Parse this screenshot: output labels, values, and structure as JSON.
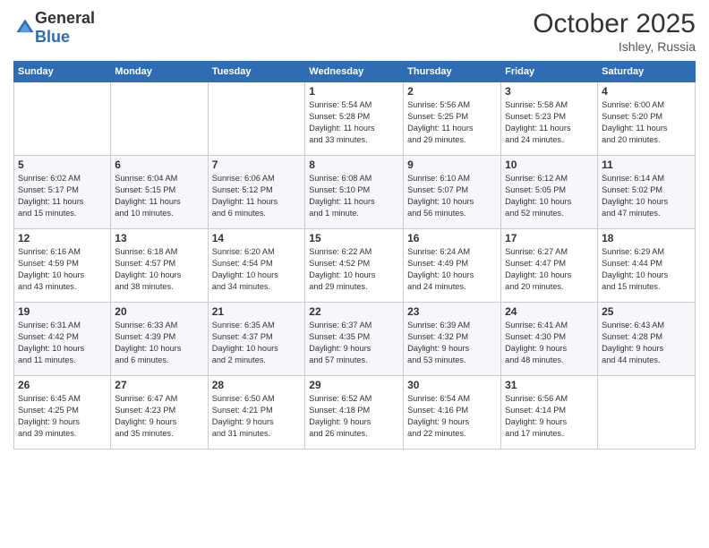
{
  "logo": {
    "general": "General",
    "blue": "Blue"
  },
  "title": "October 2025",
  "location": "Ishley, Russia",
  "days_header": [
    "Sunday",
    "Monday",
    "Tuesday",
    "Wednesday",
    "Thursday",
    "Friday",
    "Saturday"
  ],
  "weeks": [
    [
      {
        "day": "",
        "info": ""
      },
      {
        "day": "",
        "info": ""
      },
      {
        "day": "",
        "info": ""
      },
      {
        "day": "1",
        "info": "Sunrise: 5:54 AM\nSunset: 5:28 PM\nDaylight: 11 hours\nand 33 minutes."
      },
      {
        "day": "2",
        "info": "Sunrise: 5:56 AM\nSunset: 5:25 PM\nDaylight: 11 hours\nand 29 minutes."
      },
      {
        "day": "3",
        "info": "Sunrise: 5:58 AM\nSunset: 5:23 PM\nDaylight: 11 hours\nand 24 minutes."
      },
      {
        "day": "4",
        "info": "Sunrise: 6:00 AM\nSunset: 5:20 PM\nDaylight: 11 hours\nand 20 minutes."
      }
    ],
    [
      {
        "day": "5",
        "info": "Sunrise: 6:02 AM\nSunset: 5:17 PM\nDaylight: 11 hours\nand 15 minutes."
      },
      {
        "day": "6",
        "info": "Sunrise: 6:04 AM\nSunset: 5:15 PM\nDaylight: 11 hours\nand 10 minutes."
      },
      {
        "day": "7",
        "info": "Sunrise: 6:06 AM\nSunset: 5:12 PM\nDaylight: 11 hours\nand 6 minutes."
      },
      {
        "day": "8",
        "info": "Sunrise: 6:08 AM\nSunset: 5:10 PM\nDaylight: 11 hours\nand 1 minute."
      },
      {
        "day": "9",
        "info": "Sunrise: 6:10 AM\nSunset: 5:07 PM\nDaylight: 10 hours\nand 56 minutes."
      },
      {
        "day": "10",
        "info": "Sunrise: 6:12 AM\nSunset: 5:05 PM\nDaylight: 10 hours\nand 52 minutes."
      },
      {
        "day": "11",
        "info": "Sunrise: 6:14 AM\nSunset: 5:02 PM\nDaylight: 10 hours\nand 47 minutes."
      }
    ],
    [
      {
        "day": "12",
        "info": "Sunrise: 6:16 AM\nSunset: 4:59 PM\nDaylight: 10 hours\nand 43 minutes."
      },
      {
        "day": "13",
        "info": "Sunrise: 6:18 AM\nSunset: 4:57 PM\nDaylight: 10 hours\nand 38 minutes."
      },
      {
        "day": "14",
        "info": "Sunrise: 6:20 AM\nSunset: 4:54 PM\nDaylight: 10 hours\nand 34 minutes."
      },
      {
        "day": "15",
        "info": "Sunrise: 6:22 AM\nSunset: 4:52 PM\nDaylight: 10 hours\nand 29 minutes."
      },
      {
        "day": "16",
        "info": "Sunrise: 6:24 AM\nSunset: 4:49 PM\nDaylight: 10 hours\nand 24 minutes."
      },
      {
        "day": "17",
        "info": "Sunrise: 6:27 AM\nSunset: 4:47 PM\nDaylight: 10 hours\nand 20 minutes."
      },
      {
        "day": "18",
        "info": "Sunrise: 6:29 AM\nSunset: 4:44 PM\nDaylight: 10 hours\nand 15 minutes."
      }
    ],
    [
      {
        "day": "19",
        "info": "Sunrise: 6:31 AM\nSunset: 4:42 PM\nDaylight: 10 hours\nand 11 minutes."
      },
      {
        "day": "20",
        "info": "Sunrise: 6:33 AM\nSunset: 4:39 PM\nDaylight: 10 hours\nand 6 minutes."
      },
      {
        "day": "21",
        "info": "Sunrise: 6:35 AM\nSunset: 4:37 PM\nDaylight: 10 hours\nand 2 minutes."
      },
      {
        "day": "22",
        "info": "Sunrise: 6:37 AM\nSunset: 4:35 PM\nDaylight: 9 hours\nand 57 minutes."
      },
      {
        "day": "23",
        "info": "Sunrise: 6:39 AM\nSunset: 4:32 PM\nDaylight: 9 hours\nand 53 minutes."
      },
      {
        "day": "24",
        "info": "Sunrise: 6:41 AM\nSunset: 4:30 PM\nDaylight: 9 hours\nand 48 minutes."
      },
      {
        "day": "25",
        "info": "Sunrise: 6:43 AM\nSunset: 4:28 PM\nDaylight: 9 hours\nand 44 minutes."
      }
    ],
    [
      {
        "day": "26",
        "info": "Sunrise: 6:45 AM\nSunset: 4:25 PM\nDaylight: 9 hours\nand 39 minutes."
      },
      {
        "day": "27",
        "info": "Sunrise: 6:47 AM\nSunset: 4:23 PM\nDaylight: 9 hours\nand 35 minutes."
      },
      {
        "day": "28",
        "info": "Sunrise: 6:50 AM\nSunset: 4:21 PM\nDaylight: 9 hours\nand 31 minutes."
      },
      {
        "day": "29",
        "info": "Sunrise: 6:52 AM\nSunset: 4:18 PM\nDaylight: 9 hours\nand 26 minutes."
      },
      {
        "day": "30",
        "info": "Sunrise: 6:54 AM\nSunset: 4:16 PM\nDaylight: 9 hours\nand 22 minutes."
      },
      {
        "day": "31",
        "info": "Sunrise: 6:56 AM\nSunset: 4:14 PM\nDaylight: 9 hours\nand 17 minutes."
      },
      {
        "day": "",
        "info": ""
      }
    ]
  ]
}
